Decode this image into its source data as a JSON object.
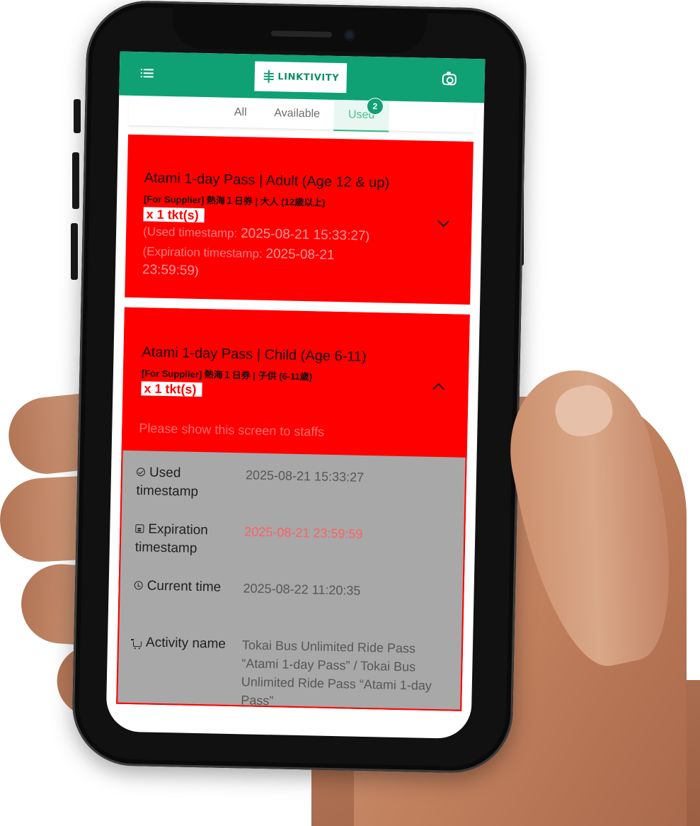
{
  "header": {
    "logo_text": "LINKTIVITY",
    "menu_icon": "menu-icon",
    "scan_icon": "camera-icon",
    "brand_color": "#0fa074"
  },
  "tabs": {
    "items": [
      {
        "label": "All"
      },
      {
        "label": "Available"
      },
      {
        "label": "Used",
        "active": true
      }
    ],
    "used_badge": "2"
  },
  "tickets": [
    {
      "title": "Atami 1-day Pass | Adult (Age 12 & up)",
      "supplier_label": "[For Supplier] 熱海１日券 | 大人 (12歳以上)",
      "quantity": "x 1 tkt(s)",
      "used_prefix": " (Used timestamp: ",
      "used_value": "2025-08-21 15:33:27",
      "used_suffix": ")",
      "exp_prefix": " (Expiration timestamp: ",
      "exp_value_line1": "2025-08-21",
      "exp_value_line2": "23:59:59",
      "exp_suffix": ")",
      "expanded": false
    },
    {
      "title": "Atami 1-day Pass | Child (Age 6-11)",
      "supplier_label": "[For Supplier] 熱海１日券 | 子供 (6-11歳)",
      "quantity": "x 1 tkt(s)",
      "notice": "Please show this screen to staffs",
      "expanded": true,
      "details": {
        "used_label": "Used timestamp",
        "used_value": "2025-08-21 15:33:27",
        "expiration_label": "Expiration timestamp",
        "expiration_value": "2025-08-21 23:59:59",
        "current_label": "Current time",
        "current_value": "2025-08-22 11:20:35",
        "activity_label": "Activity name",
        "activity_value": "Tokai Bus Unlimited Ride Pass “Atami 1-day Pass” / Tokai Bus Unlimited Ride Pass “Atami 1-day Pass”"
      }
    }
  ],
  "colors": {
    "ticket_used_bg": "#ff0000",
    "details_bg": "#a8a8a8",
    "expired_text": "#ff6161"
  }
}
